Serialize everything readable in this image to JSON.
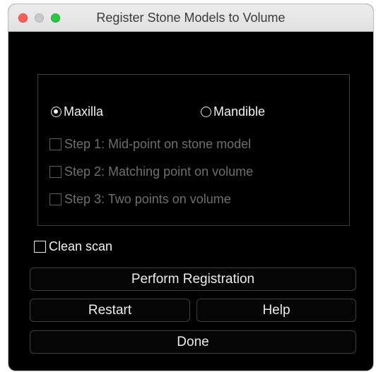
{
  "window": {
    "title": "Register Stone Models to Volume"
  },
  "jaw": {
    "options": [
      {
        "label": "Maxilla",
        "selected": true
      },
      {
        "label": "Mandible",
        "selected": false
      }
    ]
  },
  "steps": [
    {
      "label": "Step 1: Mid-point on stone model",
      "checked": false,
      "enabled": false
    },
    {
      "label": "Step 2: Matching point on volume",
      "checked": false,
      "enabled": false
    },
    {
      "label": "Step 3: Two points on volume",
      "checked": false,
      "enabled": false
    }
  ],
  "clean_scan": {
    "label": "Clean scan",
    "checked": false
  },
  "buttons": {
    "perform_registration": "Perform Registration",
    "restart": "Restart",
    "help": "Help",
    "done": "Done"
  }
}
